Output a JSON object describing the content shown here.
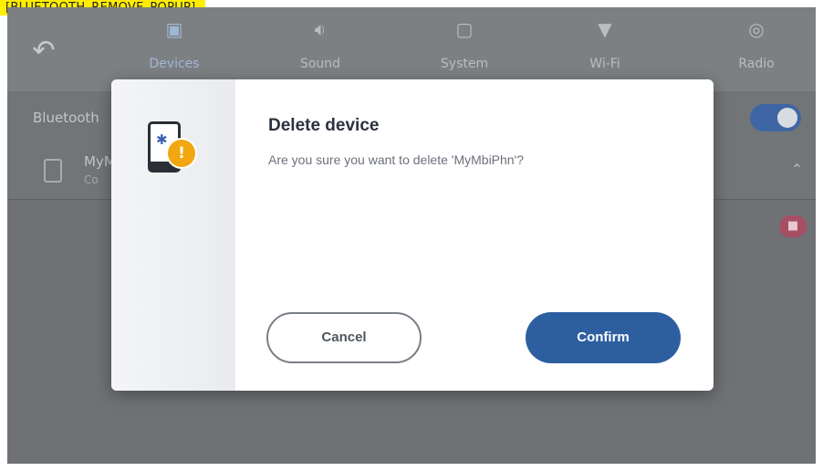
{
  "banner": {
    "text": "[BLUETOOTH_REMOVE_POPUP]"
  },
  "topbar": {
    "back_icon": "back-arrow-icon",
    "tabs": [
      {
        "label": "Devices",
        "icon": "devices-icon",
        "active": true
      },
      {
        "label": "Sound",
        "icon": "speaker-icon",
        "active": false
      },
      {
        "label": "System",
        "icon": "system-icon",
        "active": false
      },
      {
        "label": "Wi-Fi",
        "icon": "wifi-icon",
        "active": false
      },
      {
        "label": "Radio",
        "icon": "radio-icon",
        "active": false
      }
    ]
  },
  "background": {
    "bluetooth_label": "Bluetooth",
    "bluetooth_enabled": true,
    "device_name": "MyM",
    "device_sub": "Co"
  },
  "dialog": {
    "title": "Delete device",
    "message": "Are you sure you want to delete 'MyMbiPhn'?",
    "icon": "bluetooth-phone-warning-icon",
    "cancel_label": "Cancel",
    "confirm_label": "Confirm"
  },
  "colors": {
    "accent": "#2d5fa0",
    "warning": "#f2a60f",
    "toggle_on": "#3f66a4",
    "delete_badge": "#a64f63"
  }
}
